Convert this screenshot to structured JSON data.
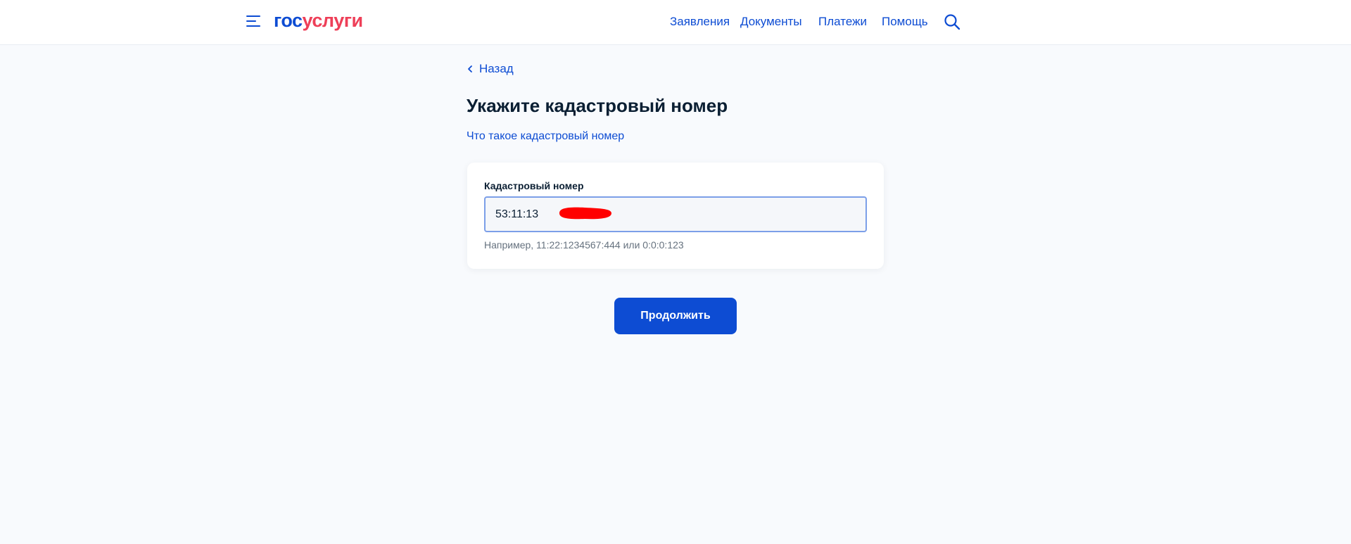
{
  "header": {
    "logo_part1": "гос",
    "logo_part2": "услуги",
    "nav": [
      {
        "label": "Заявления"
      },
      {
        "label": "Документы"
      },
      {
        "label": "Платежи"
      },
      {
        "label": "Помощь"
      }
    ]
  },
  "main": {
    "back_label": "Назад",
    "title": "Укажите кадастровый номер",
    "info_link": "Что такое кадастровый номер",
    "field": {
      "label": "Кадастровый номер",
      "value": "53:11:13",
      "hint": "Например, 11:22:1234567:444 или 0:0:0:123"
    },
    "submit_label": "Продолжить"
  },
  "colors": {
    "brand_blue": "#0d4cd3",
    "brand_red": "#ee3f58",
    "page_bg": "#f8fafd",
    "input_focus_border": "#7c9fe8",
    "redaction": "#ff0000"
  },
  "icons": {
    "menu": "burger-menu-icon",
    "search": "search-icon",
    "back": "chevron-left-icon"
  }
}
